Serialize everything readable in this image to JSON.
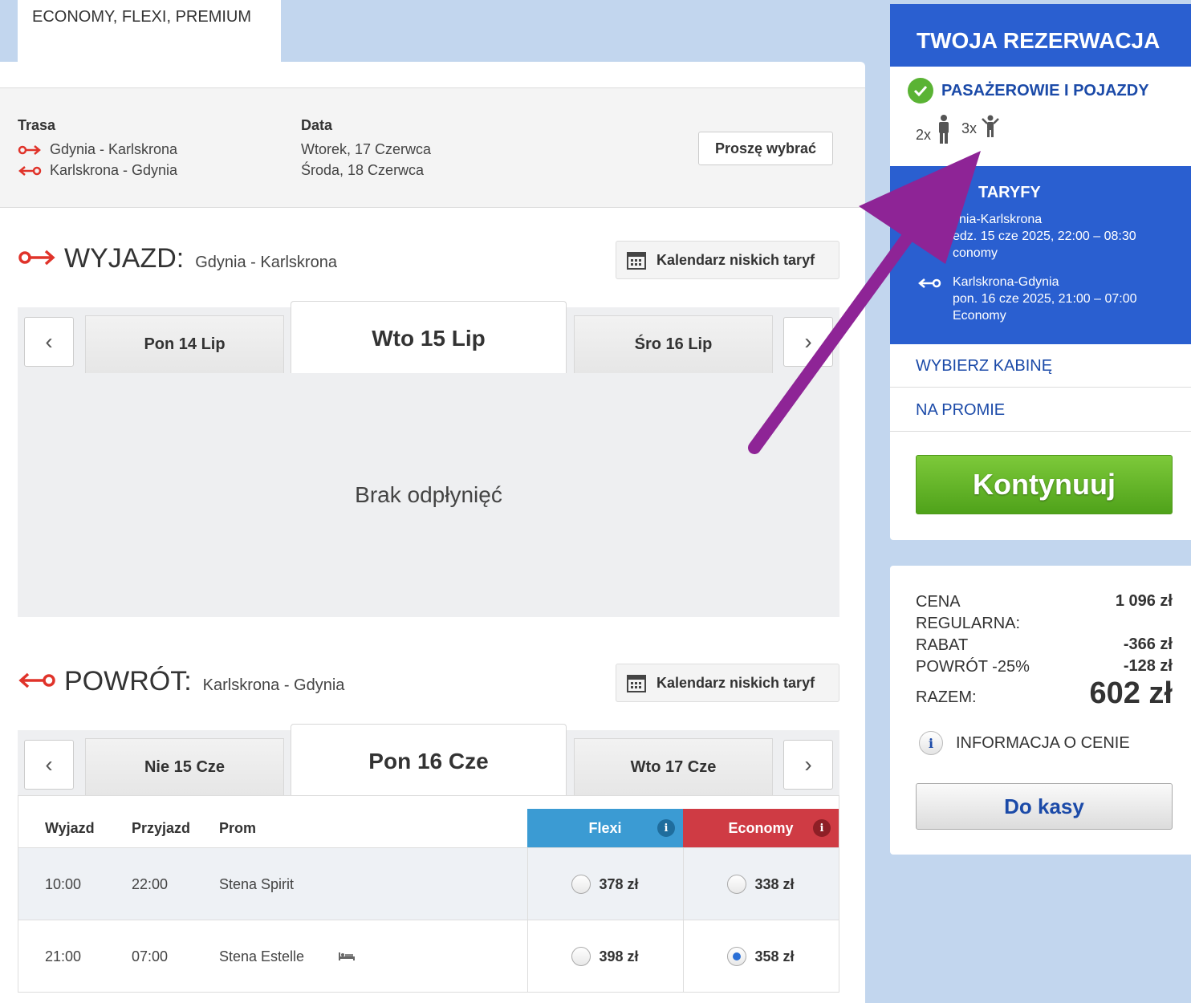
{
  "top_tab": {
    "label": "ECONOMY, FLEXI, PREMIUM"
  },
  "summary": {
    "route_label": "Trasa",
    "date_label": "Data",
    "outbound_route": "Gdynia - Karlskrona",
    "return_route": "Karlskrona - Gdynia",
    "outbound_date": "Wtorek, 17 Czerwca",
    "return_date": "Środa, 18 Czerwca",
    "choose_button": "Proszę wybrać"
  },
  "outbound": {
    "title": "WYJAZD:",
    "route": "Gdynia - Karlskrona",
    "calendar_button": "Kalendarz niskich taryf",
    "prev_date": "Pon 14 Lip",
    "active_date": "Wto 15 Lip",
    "next_date": "Śro 16 Lip",
    "empty_message": "Brak odpłynięć"
  },
  "return": {
    "title": "POWRÓT:",
    "route": "Karlskrona - Gdynia",
    "calendar_button": "Kalendarz niskich taryf",
    "prev_date": "Nie 15 Cze",
    "active_date": "Pon 16 Cze",
    "next_date": "Wto 17 Cze"
  },
  "table": {
    "headers": {
      "departure": "Wyjazd",
      "arrival": "Przyjazd",
      "ferry": "Prom",
      "flexi": "Flexi",
      "economy": "Economy"
    },
    "rows": [
      {
        "departure": "10:00",
        "arrival": "22:00",
        "ferry": "Stena Spirit",
        "flexi_price": "378 zł",
        "economy_price": "338 zł",
        "selected": "none"
      },
      {
        "departure": "21:00",
        "arrival": "07:00",
        "ferry": "Stena Estelle",
        "flexi_price": "398 zł",
        "economy_price": "358 zł",
        "selected": "economy"
      }
    ]
  },
  "sidebar": {
    "title": "TWOJA REZERWACJA",
    "passengers_title": "PASAŻEROWIE I POJAZDY",
    "adults": "2x",
    "children": "3x",
    "fares_title": "TARYFY",
    "out_route": "ynia-Karlskrona",
    "out_date": "edz. 15 cze 2025, 22:00 – 08:30",
    "out_class": "conomy",
    "ret_route": "Karlskrona-Gdynia",
    "ret_date": "pon. 16 cze 2025, 21:00 – 07:00",
    "ret_class": "Economy",
    "cabin_link": "WYBIERZ KABINĘ",
    "onboard_link": "NA PROMIE",
    "continue_button": "Kontynuuj"
  },
  "price": {
    "regular_label_1": "CENA",
    "regular_label_2": "REGULARNA:",
    "regular_value": "1 096 zł",
    "discount_label": "RABAT",
    "discount_value": "-366 zł",
    "return_label": "POWRÓT -25%",
    "return_value": "-128 zł",
    "total_label": "RAZEM:",
    "total_value": "602 zł",
    "info_label": "INFORMACJA O CENIE",
    "checkout_button": "Do kasy"
  },
  "colors": {
    "brand_blue": "#2a5fd0",
    "flexi": "#3b9bd3",
    "economy": "#cf3b44",
    "continue_green": "#5fb025",
    "arrow_purple": "#8e2496",
    "route_red": "#e0332a"
  }
}
